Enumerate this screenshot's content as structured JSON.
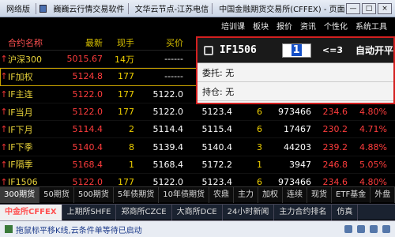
{
  "titlebar": {
    "left_title": "网络版",
    "app_title": "巍巍云行情交易软件",
    "node": "文华云节点-江苏电信",
    "page_title": "中国金融期货交易所(CFFEX) - 页面",
    "min": "—",
    "max": "□",
    "close": "×"
  },
  "menu": [
    "培训课",
    "板块",
    "报价",
    "资讯",
    "个性化",
    "系统工具"
  ],
  "table": {
    "headers": {
      "name": "合约名称",
      "new": "最新",
      "hand": "现手",
      "bid": "买价"
    },
    "rows": [
      {
        "name": "沪深300",
        "new": "5015.67",
        "hand": "14万",
        "bid": "------",
        "ask": "",
        "vol": "",
        "oi": "",
        "chg": "",
        "pct": ""
      },
      {
        "name": "IF加权",
        "new": "5124.8",
        "hand": "177",
        "bid": "------",
        "ask": "",
        "vol": "",
        "oi": "",
        "chg": "",
        "pct": ""
      },
      {
        "name": "IF主连",
        "new": "5122.0",
        "hand": "177",
        "bid": "5122.0",
        "ask": "5122.4",
        "vol": "",
        "oi": "",
        "chg": "",
        "pct": ""
      },
      {
        "name": "IF当月",
        "new": "5122.0",
        "hand": "177",
        "bid": "5122.0",
        "ask": "5123.4",
        "vol": "6",
        "oi": "973466",
        "chg": "234.6",
        "pct": "4.80%"
      },
      {
        "name": "IF下月",
        "new": "5114.4",
        "hand": "2",
        "bid": "5114.4",
        "ask": "5115.4",
        "vol": "6",
        "oi": "17467",
        "chg": "230.2",
        "pct": "4.71%"
      },
      {
        "name": "IF下季",
        "new": "5140.4",
        "hand": "8",
        "bid": "5139.4",
        "ask": "5140.4",
        "vol": "3",
        "oi": "44203",
        "chg": "239.2",
        "pct": "4.88%"
      },
      {
        "name": "IF隔季",
        "new": "5168.4",
        "hand": "1",
        "bid": "5168.4",
        "ask": "5172.2",
        "vol": "1",
        "oi": "3947",
        "chg": "246.8",
        "pct": "5.05%"
      },
      {
        "name": "IF1506",
        "new": "5122.0",
        "hand": "177",
        "bid": "5122.0",
        "ask": "5123.4",
        "vol": "6",
        "oi": "973466",
        "chg": "234.6",
        "pct": "4.80%"
      }
    ]
  },
  "popup": {
    "contract": "IF1506",
    "qty": "1",
    "limit": "<=3",
    "auto_label": "自动开平",
    "order_label": "委托: 无",
    "position_label": "持仓: 无"
  },
  "tabs1": [
    "300期货",
    "50期货",
    "500期货",
    "5年债期货",
    "10年债期货",
    "农鼎",
    "主力",
    "加权",
    "连续",
    "现货",
    "ETF基金",
    "外盘"
  ],
  "tabs2": [
    "中金所CFFEX",
    "上期所SHFE",
    "郑商所CZCE",
    "大商所DCE",
    "24小时新闻",
    "主力合约排名",
    "仿真"
  ],
  "status": {
    "text": "拖鼠标平移K线,云条件单等待已启动",
    "tray_time": ""
  },
  "colors": {
    "accent_red": "#ff3c3c",
    "header_yellow": "#d8c000",
    "popup_border": "#d42020"
  }
}
